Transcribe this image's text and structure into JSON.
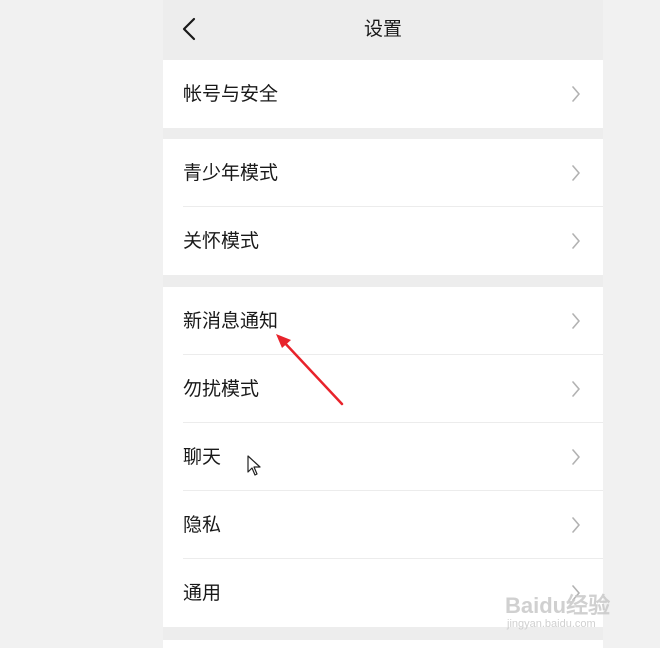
{
  "header": {
    "title": "设置"
  },
  "groups": [
    {
      "items": [
        {
          "label": "帐号与安全"
        }
      ]
    },
    {
      "items": [
        {
          "label": "青少年模式"
        },
        {
          "label": "关怀模式"
        }
      ]
    },
    {
      "items": [
        {
          "label": "新消息通知"
        },
        {
          "label": "勿扰模式"
        },
        {
          "label": "聊天"
        },
        {
          "label": "隐私"
        },
        {
          "label": "通用"
        }
      ]
    }
  ],
  "icons": {
    "back": "chevron-left-icon",
    "row_chevron": "chevron-right-icon",
    "annotation": "red-arrow-annotation",
    "pointer": "mouse-pointer-icon"
  },
  "colors": {
    "page_bg": "#f1f1f1",
    "screen_bg": "#ededed",
    "row_bg": "#ffffff",
    "text": "#191919",
    "chevron": "#b2b2b2",
    "annotation": "#e8232b"
  },
  "watermark": {
    "main": "Baidu经验",
    "sub": "jingyan.baidu.com"
  }
}
